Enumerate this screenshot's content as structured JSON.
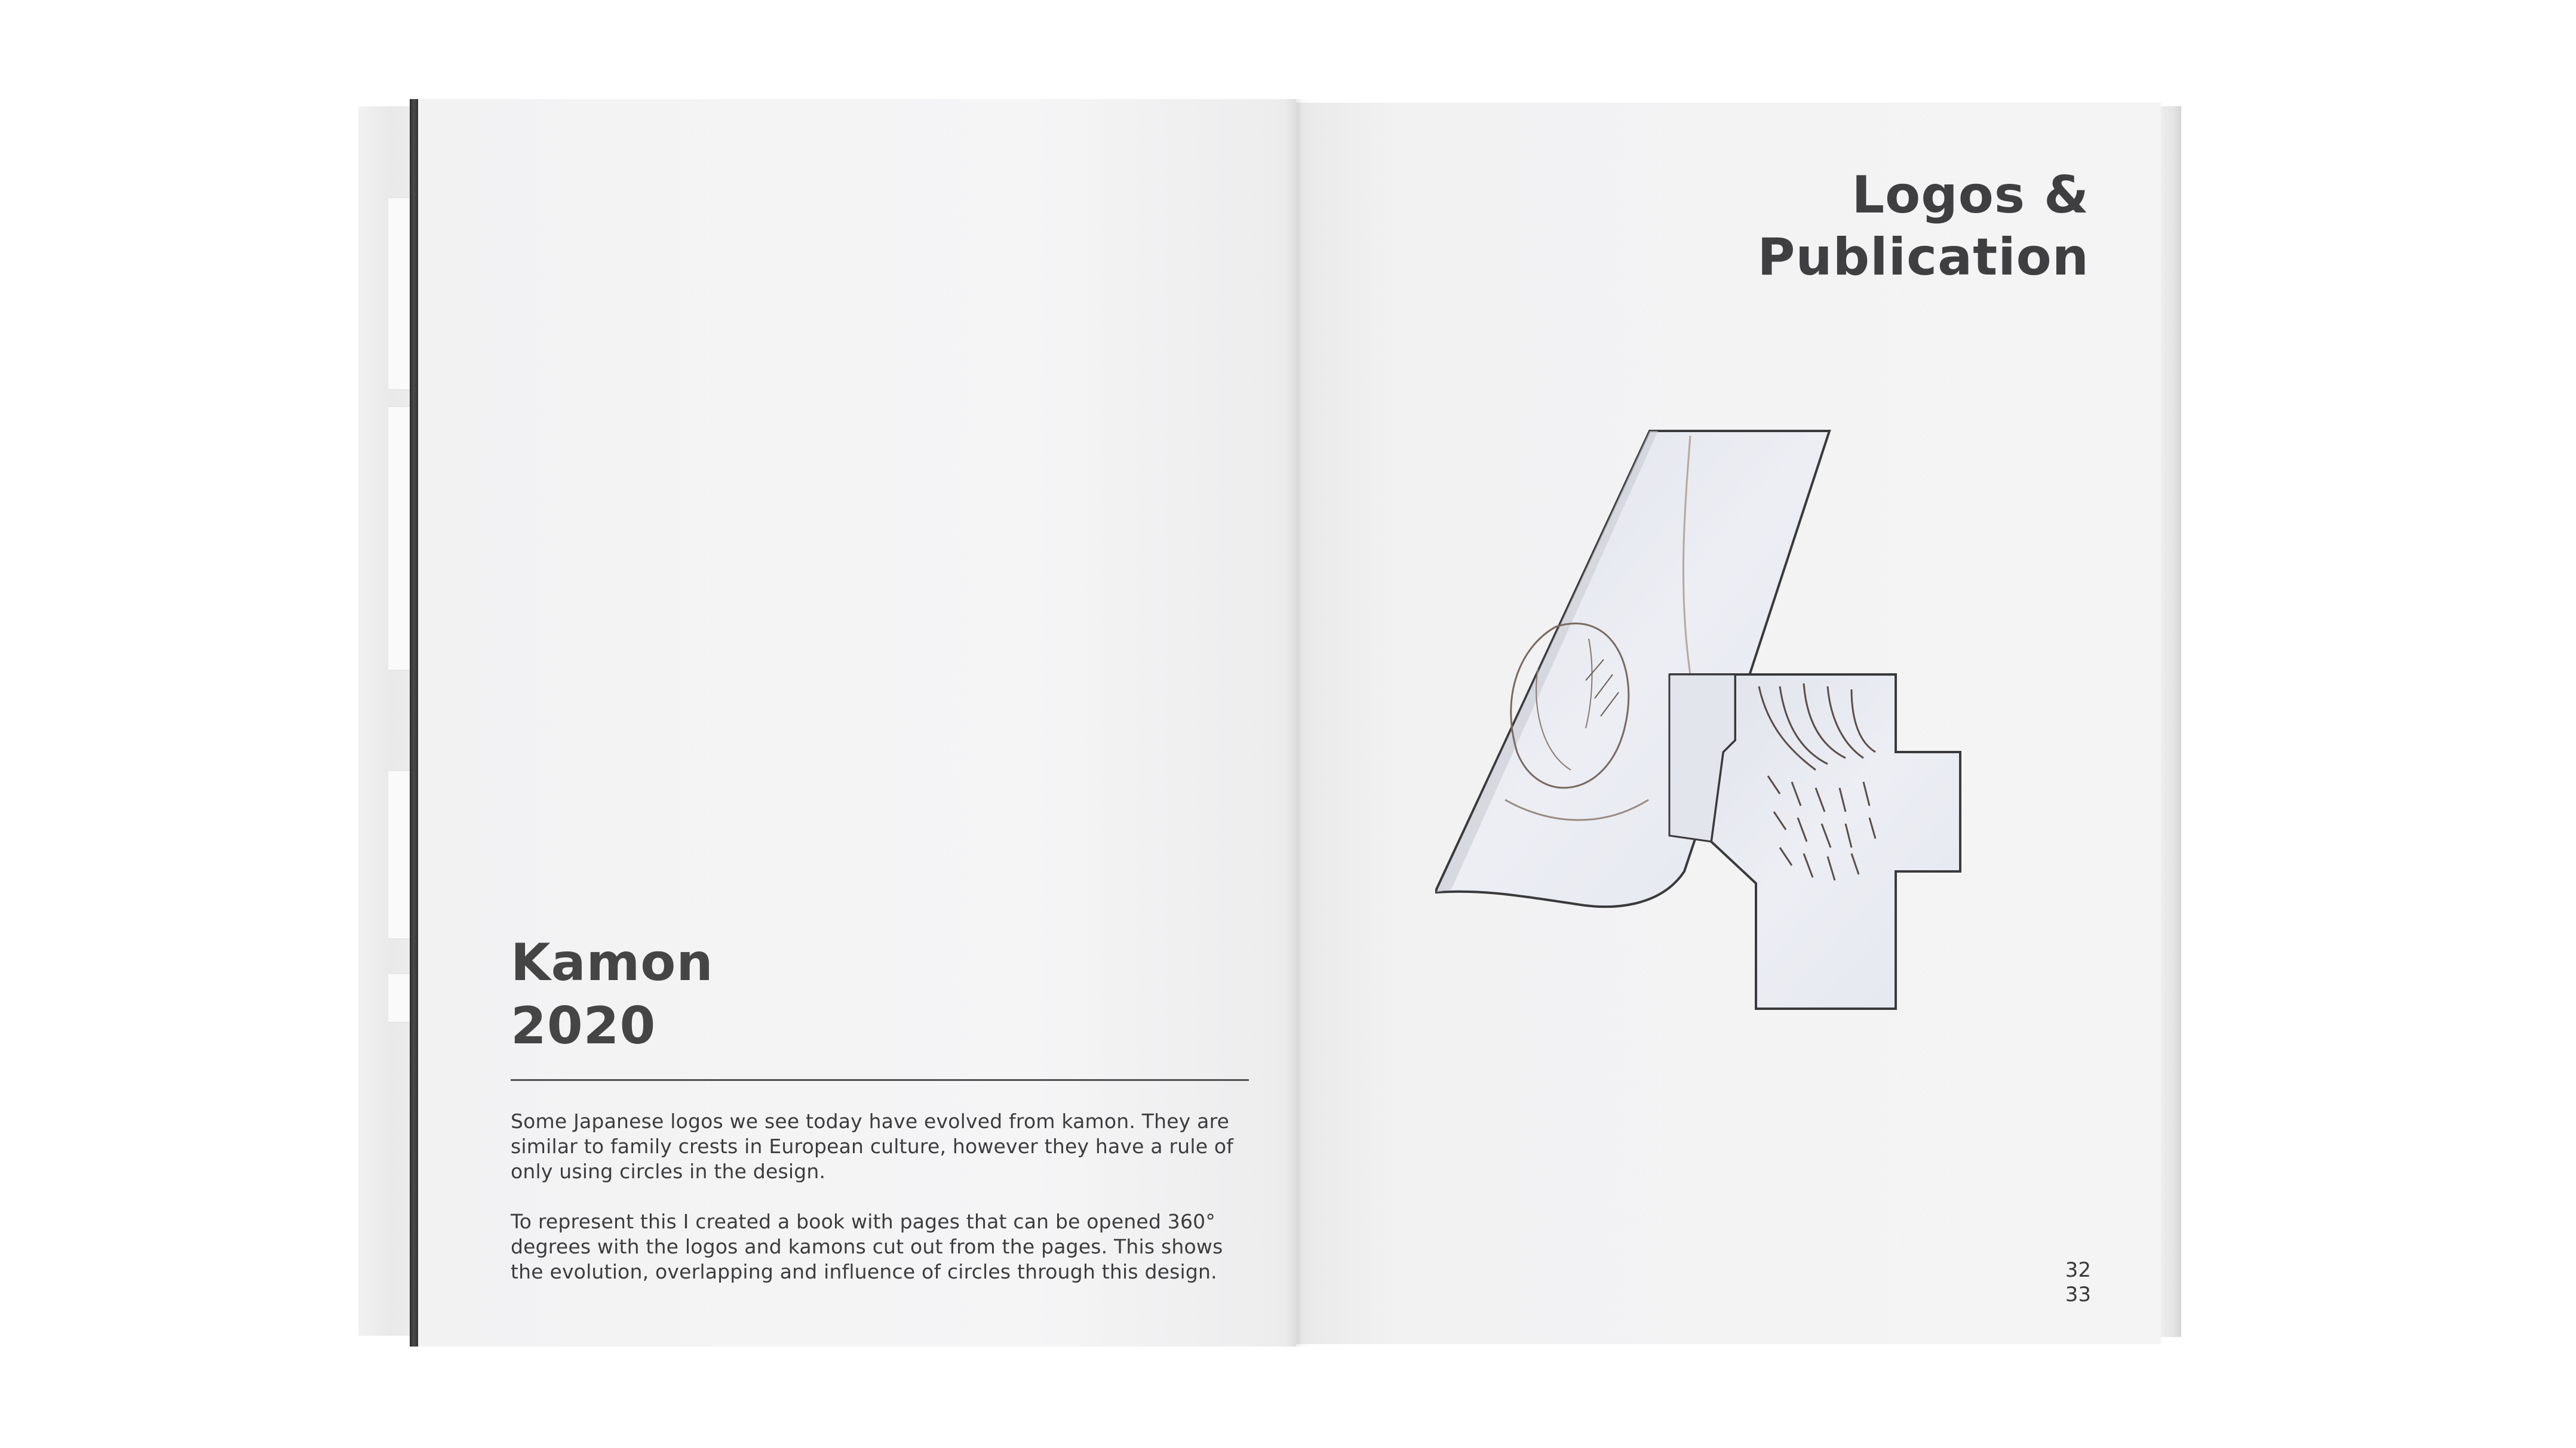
{
  "left_page": {
    "title_line1": "Kamon",
    "title_line2": "2020",
    "paragraph1": "Some Japanese logos we see today have evolved from kamon. They are similar to family crests in European culture, however they have a rule of only using circles in the design.",
    "paragraph2": "To represent this I created a book with pages that can be opened 360° degrees with the logos and kamons cut out from the pages. This shows the evolution, overlapping and influence of circles through this design."
  },
  "right_page": {
    "title_line1": "Logos &",
    "title_line2": "Publication",
    "cutout_numeral": "4",
    "page_number_left": "32",
    "page_number_right": "33"
  },
  "colors": {
    "paper": "#f4f4f5",
    "ink": "#424244",
    "background": "#ffffff",
    "cutout_inner": "#e9ecf3"
  }
}
